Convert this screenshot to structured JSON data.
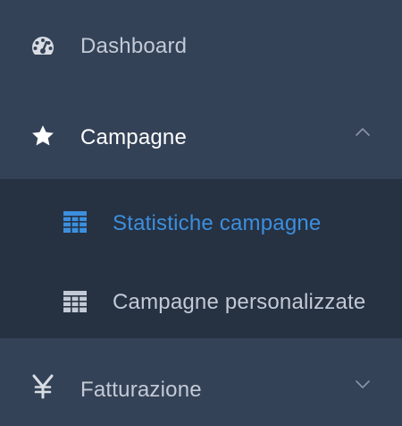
{
  "menu": {
    "items": [
      {
        "label": "Dashboard",
        "icon": "dashboard-gauge-icon"
      },
      {
        "label": "Campagne",
        "icon": "star-icon",
        "expanded": true,
        "chevron": "chevron-up-icon",
        "children": [
          {
            "label": "Statistiche campagne",
            "icon": "grid-table-icon",
            "selected": true
          },
          {
            "label": "Campagne personalizzate",
            "icon": "grid-table-icon",
            "selected": false
          }
        ]
      },
      {
        "label": "Fatturazione",
        "icon": "yen-icon",
        "expanded": false,
        "chevron": "chevron-down-icon"
      }
    ]
  },
  "colors": {
    "background": "#344257",
    "submenu_background": "#263142",
    "text": "#c3cad6",
    "active_text": "#ffffff",
    "selected_accent": "#3c8fde",
    "icon": "#d9dde4",
    "chevron": "#8a95a6"
  }
}
